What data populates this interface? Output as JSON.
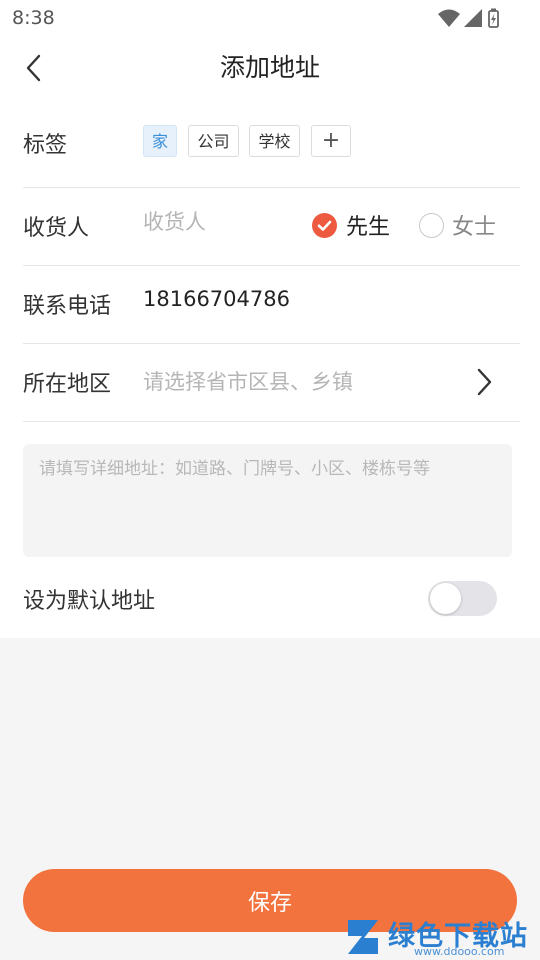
{
  "status_bar": {
    "time": "8:38"
  },
  "header": {
    "title": "添加地址",
    "back_icon": "chevron-left-icon"
  },
  "tags_row": {
    "label": "标签",
    "tags": [
      {
        "label": "家",
        "selected": true
      },
      {
        "label": "公司",
        "selected": false
      },
      {
        "label": "学校",
        "selected": false
      }
    ],
    "add_label": "+"
  },
  "receiver_row": {
    "label": "收货人",
    "placeholder": "收货人",
    "value": "",
    "gender_options": [
      {
        "label": "先生",
        "selected": true
      },
      {
        "label": "女士",
        "selected": false
      }
    ]
  },
  "phone_row": {
    "label": "联系电话",
    "value": "18166704786"
  },
  "region_row": {
    "label": "所在地区",
    "placeholder": "请选择省市区县、乡镇",
    "arrow_icon": "chevron-right-icon"
  },
  "address_detail": {
    "placeholder": "请填写详细地址：如道路、门牌号、小区、楼栋号等",
    "value": ""
  },
  "default_row": {
    "label": "设为默认地址",
    "enabled": false
  },
  "save_button": {
    "label": "保存"
  },
  "watermark": {
    "title": "绿色下载站",
    "subtitle": "www.ddooo.com"
  },
  "colors": {
    "accent": "#f2733e",
    "radio_checked": "#ee5a3f",
    "tag_selected_text": "#3a8fd9",
    "tag_selected_bg": "#e7f1fb",
    "placeholder": "#b5b5b5",
    "page_background": "#f5f5f5"
  }
}
